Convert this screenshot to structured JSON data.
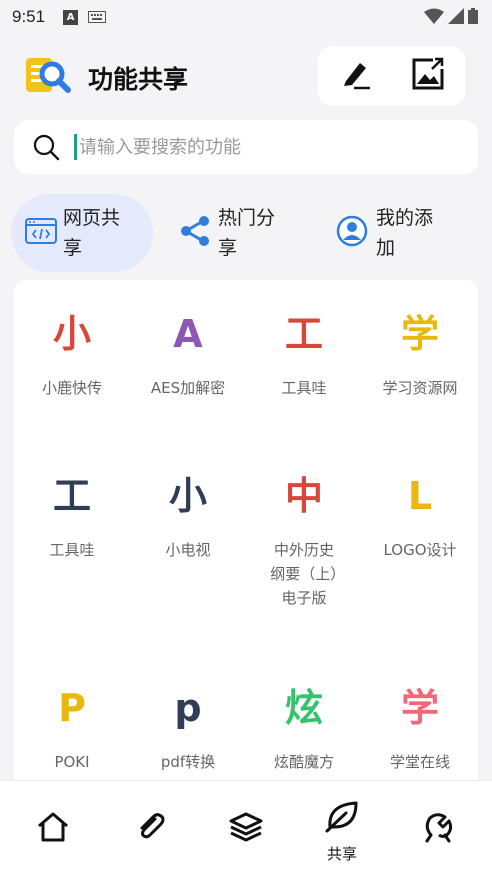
{
  "status_bar": {
    "time": "9:51",
    "a_badge": "A"
  },
  "header": {
    "title": "功能共享",
    "edit_icon": "edit-pen-icon",
    "export_icon": "image-export-icon"
  },
  "search": {
    "placeholder": "请输入要搜索的功能",
    "icon": "search-icon"
  },
  "tabs": [
    {
      "label": "网页共享",
      "icon": "web-code-icon",
      "active": true
    },
    {
      "label": "热门分享",
      "icon": "share-icon",
      "active": false
    },
    {
      "label": "我的添加",
      "icon": "user-icon",
      "active": false
    }
  ],
  "grid": [
    {
      "glyph": "小",
      "label": "小鹿快传",
      "color": "#d9463c"
    },
    {
      "glyph": "A",
      "label": "AES加解密",
      "color": "#8e57b3"
    },
    {
      "glyph": "工",
      "label": "工具哇",
      "color": "#d9463c"
    },
    {
      "glyph": "学",
      "label": "学习资源网",
      "color": "#e8b80f"
    },
    {
      "glyph": "工",
      "label": "工具哇",
      "color": "#2f3e55"
    },
    {
      "glyph": "小",
      "label": "小电视",
      "color": "#2f3e55"
    },
    {
      "glyph": "中",
      "label": "中外历史纲要（上）电子版",
      "color": "#d9463c"
    },
    {
      "glyph": "L",
      "label": "LOGO设计",
      "color": "#e8b80f"
    },
    {
      "glyph": "P",
      "label": "POKI",
      "color": "#e8b80f"
    },
    {
      "glyph": "p",
      "label": "pdf转换",
      "color": "#2f3e55"
    },
    {
      "glyph": "炫",
      "label": "炫酷魔方",
      "color": "#34c26c"
    },
    {
      "glyph": "学",
      "label": "学堂在线",
      "color": "#f06778"
    }
  ],
  "bottom_nav": [
    {
      "icon": "home-icon",
      "label": ""
    },
    {
      "icon": "attachment-icon",
      "label": ""
    },
    {
      "icon": "layers-icon",
      "label": ""
    },
    {
      "icon": "leaf-icon",
      "label": "共享",
      "active": true
    },
    {
      "icon": "tools-icon",
      "label": ""
    }
  ],
  "colors": {
    "accent": "#2f7de1",
    "active_tab_bg": "#e4e9fb",
    "caret": "#1aa085"
  }
}
